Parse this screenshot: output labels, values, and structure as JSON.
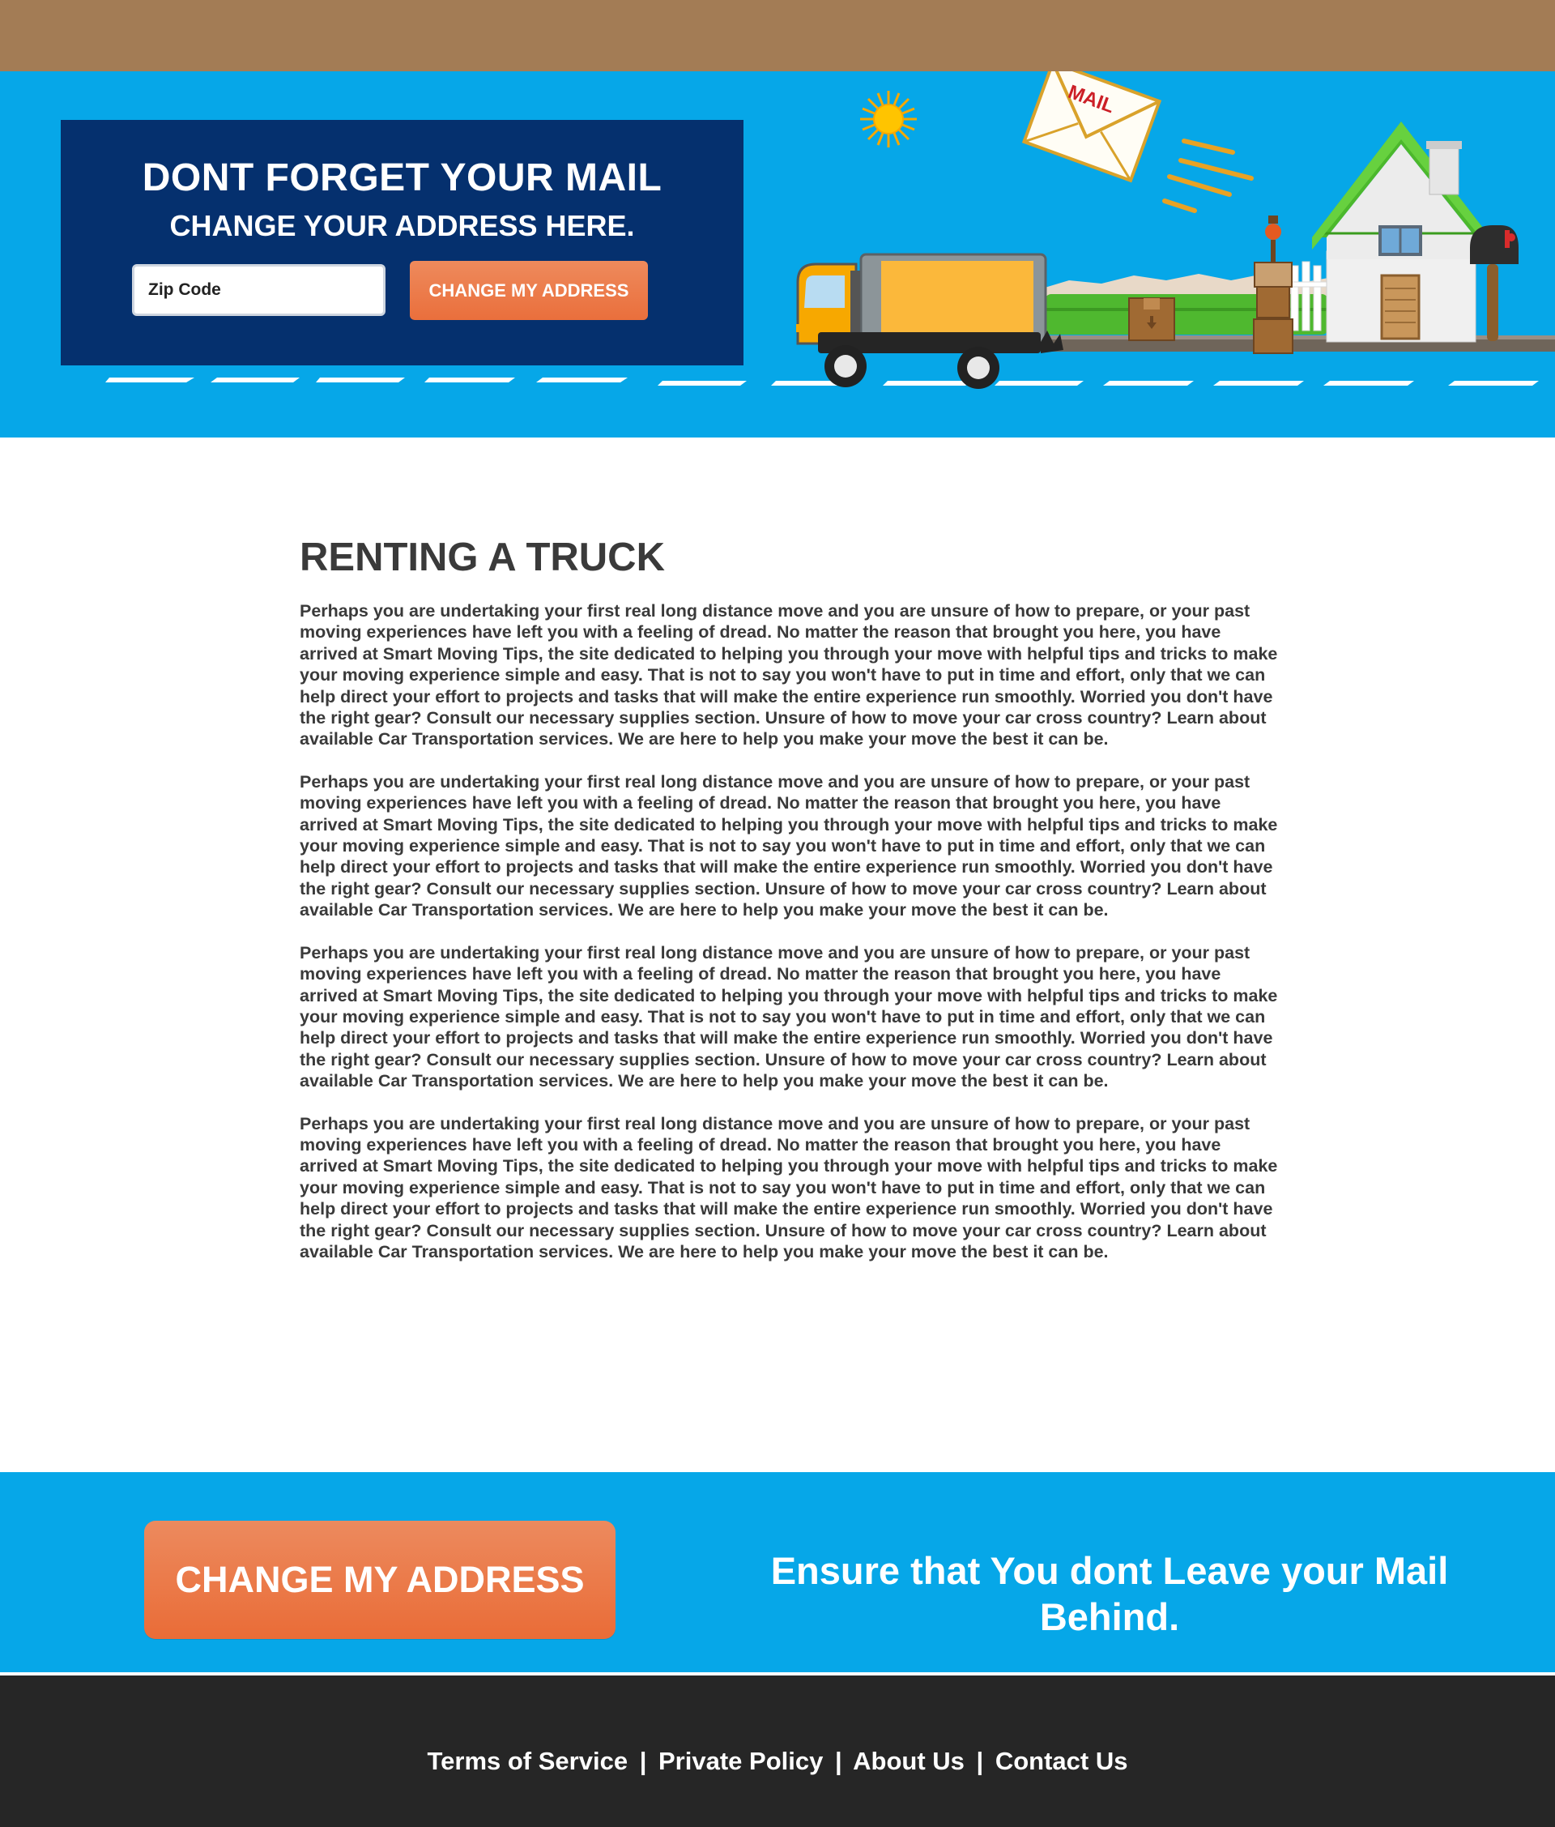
{
  "hero": {
    "title": "DONT FORGET YOUR MAIL",
    "subtitle": "CHANGE YOUR ADDRESS HERE.",
    "zip_placeholder": "Zip Code",
    "button_label": "CHANGE MY ADDRESS",
    "envelope_label": "MAIL"
  },
  "article": {
    "heading": "RENTING A TRUCK",
    "paragraphs": [
      "Perhaps you are undertaking your first real long distance move and you are unsure of how to prepare, or your past moving experiences have left you with a feeling of dread.  No matter the reason that brought you here, you have arrived at Smart Moving Tips, the site dedicated to helping you through your move with helpful tips and tricks to make your moving experience simple and easy.  That is not to say you won't have to put in time and effort, only that we can help direct your effort to projects and tasks that will make the entire experience run smoothly.  Worried you don't have the right gear? Consult our necessary supplies section.  Unsure of how to move your car cross country?  Learn about available Car Transportation services.  We are here to help you make your move the best it can be.",
      "Perhaps you are undertaking your first real long distance move and you are unsure of how to prepare, or your past moving experiences have left you with a feeling of dread.  No matter the reason that brought you here, you have arrived at Smart Moving Tips, the site dedicated to helping you through your move with helpful tips and tricks to make your moving experience simple and easy.  That is not to say you won't have to put in time and effort, only that we can help direct your effort to projects and tasks that will make the entire experience run smoothly.  Worried you don't have the right gear? Consult our necessary supplies section.  Unsure of how to move your car cross country?  Learn about available Car Transportation services.  We are here to help you make your move the best it can be.",
      "Perhaps you are undertaking your first real long distance move and you are unsure of how to prepare, or your past moving experiences have left you with a feeling of dread.  No matter the reason that brought you here, you have arrived at Smart Moving Tips, the site dedicated to helping you through your move with helpful tips and tricks to make your moving experience simple and easy.  That is not to say you won't have to put in time and effort, only that we can help direct your effort to projects and tasks that will make the entire experience run smoothly.  Worried you don't have the right gear? Consult our necessary supplies section.  Unsure of how to move your car cross country?  Learn about available Car Transportation services.  We are here to help you make your move the best it can be.",
      "Perhaps you are undertaking your first real long distance move and you are unsure of how to prepare, or your past moving experiences have left you with a feeling of dread.  No matter the reason that brought you here, you have arrived at Smart Moving Tips, the site dedicated to helping you through your move with helpful tips and tricks to make your moving experience simple and easy.  That is not to say you won't have to put in time and effort, only that we can help direct your effort to projects and tasks that will make the entire experience run smoothly.  Worried you don't have the right gear? Consult our necessary supplies section.  Unsure of how to move your car cross country?  Learn about available Car Transportation services.  We are here to help you make your move the best it can be."
    ]
  },
  "cta": {
    "button_label": "CHANGE MY ADDRESS",
    "tagline": "Ensure that You dont Leave your Mail Behind."
  },
  "footer": {
    "links": [
      "Terms of Service",
      "Private Policy",
      "About Us",
      "Contact Us"
    ],
    "separator": "|"
  },
  "colors": {
    "topbar": "#a37c55",
    "sky_blue": "#06a7e8",
    "panel_navy": "#05306e",
    "accent_orange": "#ea6f3c",
    "footer_dark": "#262626",
    "text_dark": "#3a3a3a"
  },
  "icons": [
    "sun-icon",
    "mail-envelope-icon",
    "moving-truck-icon",
    "house-icon",
    "mailbox-icon",
    "cardboard-box-icon"
  ]
}
